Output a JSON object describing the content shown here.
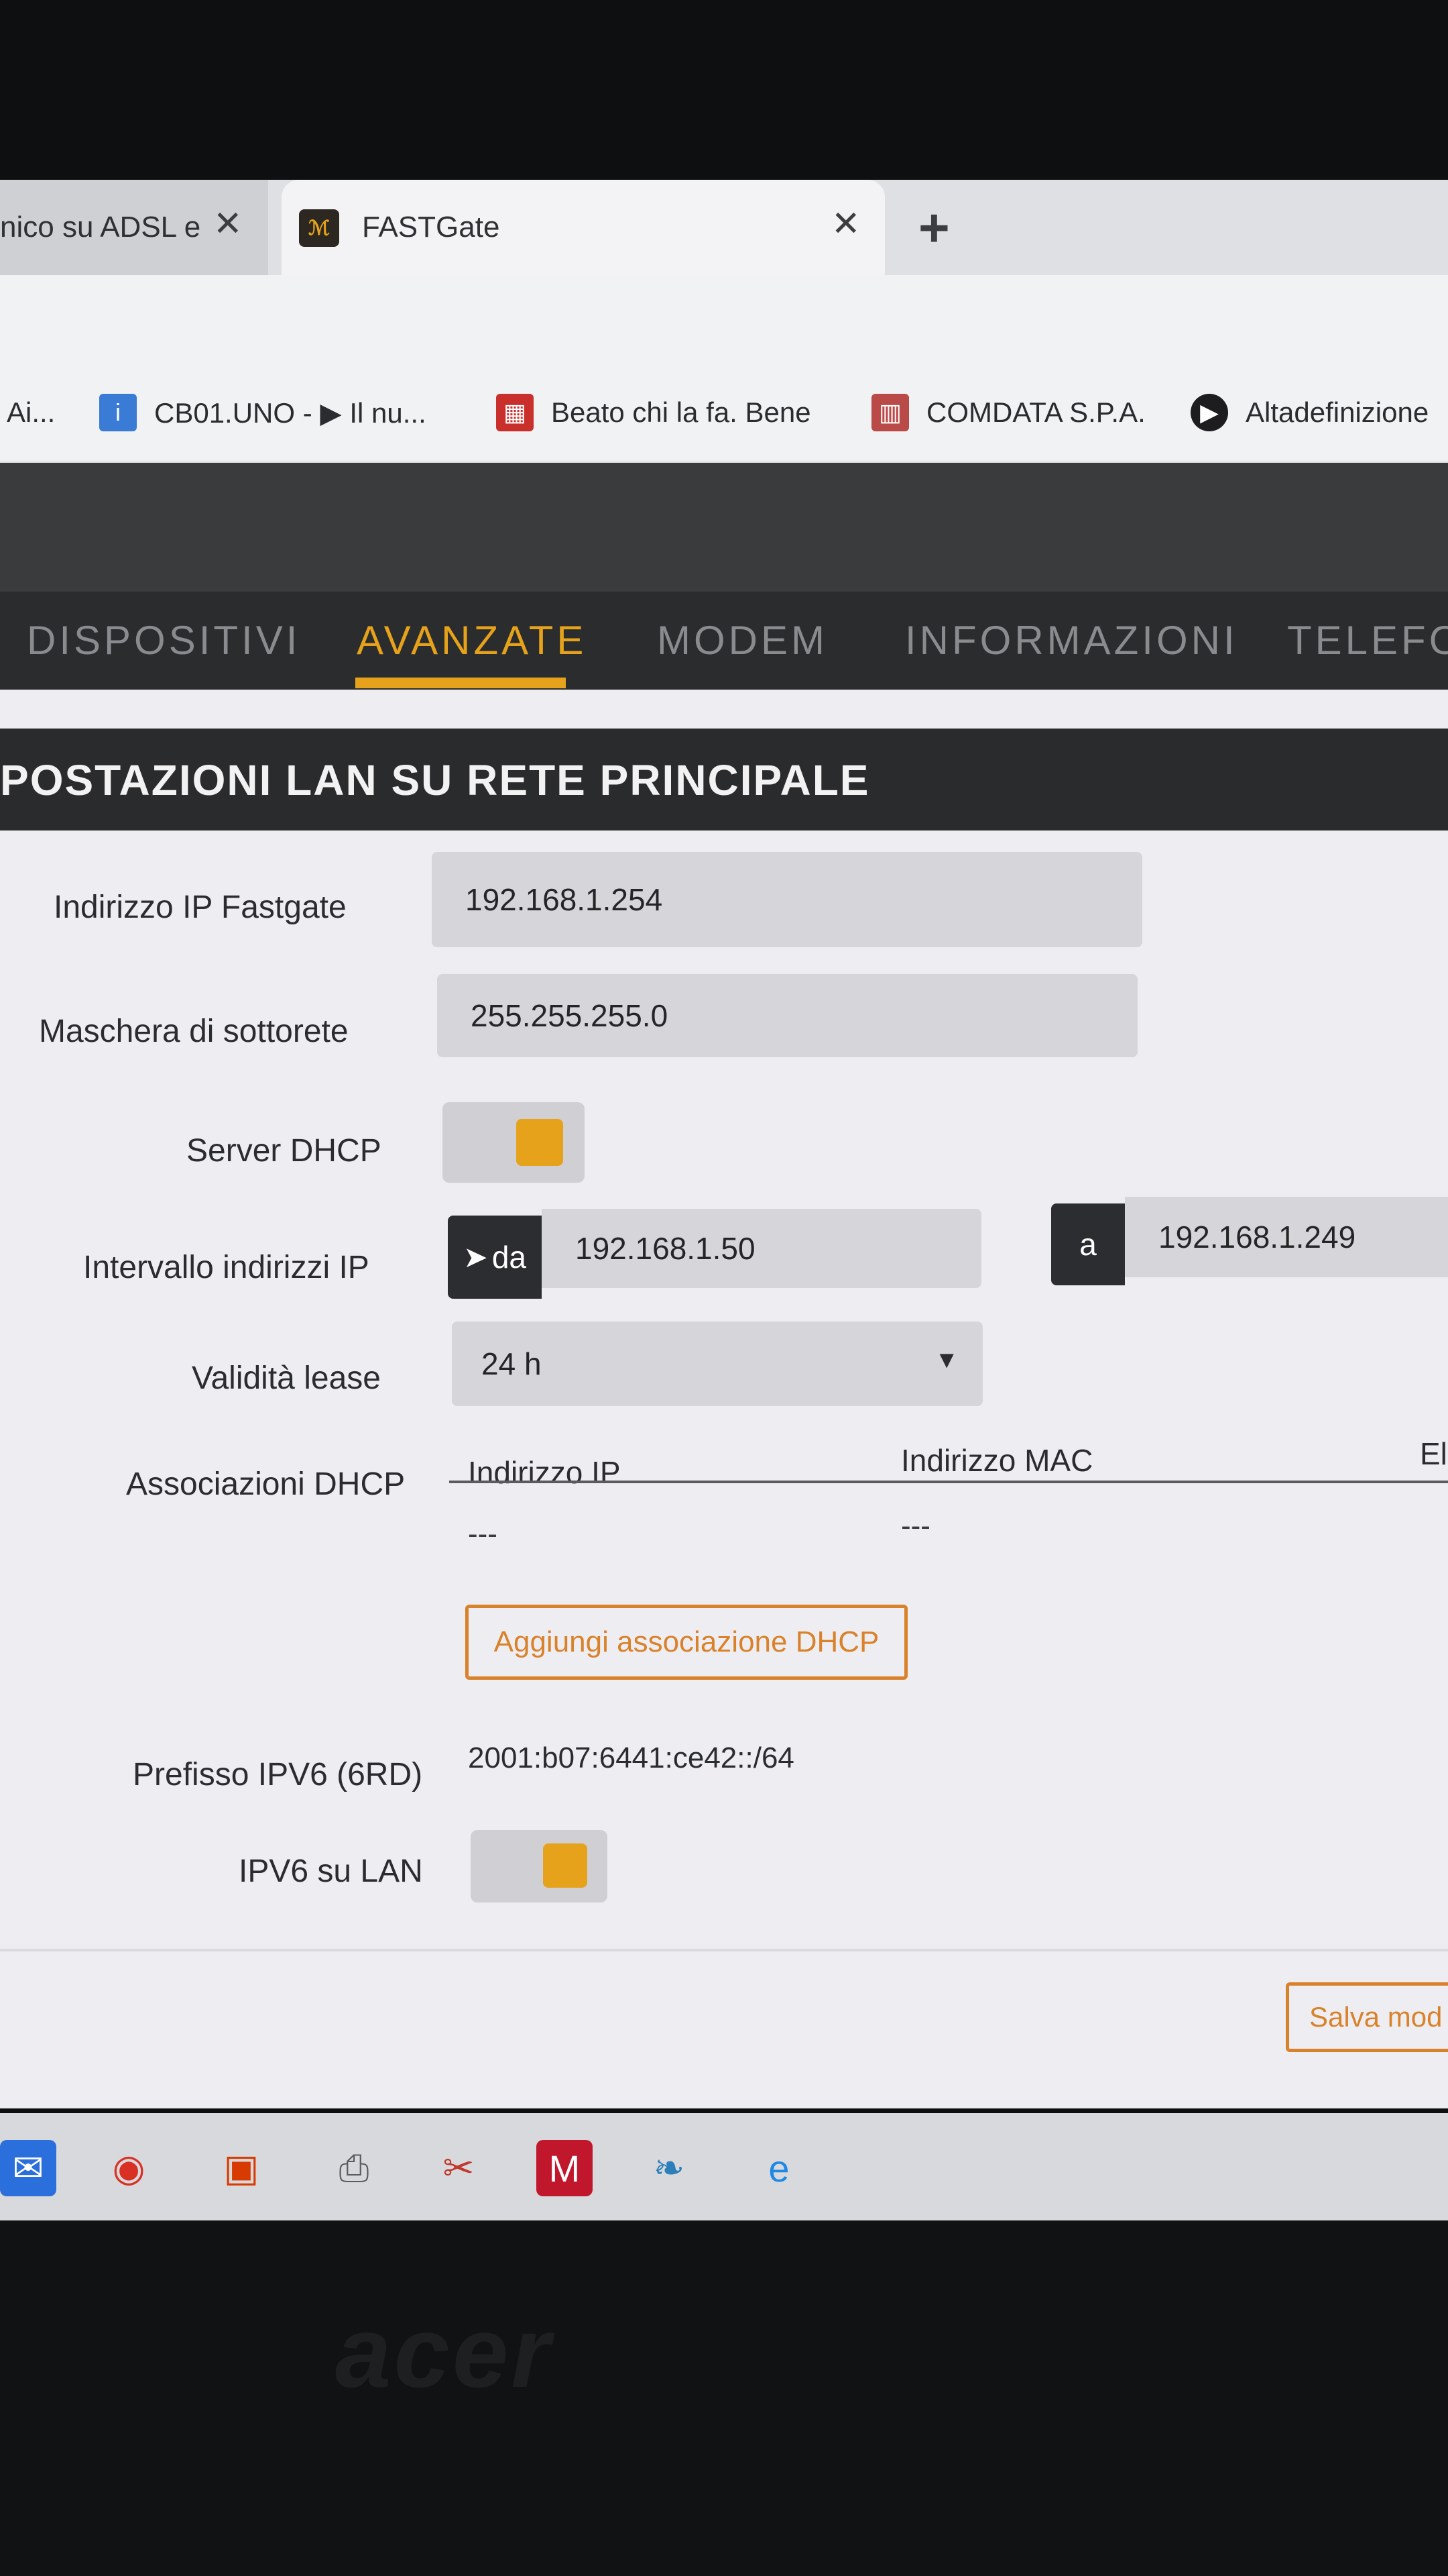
{
  "browser": {
    "tabs": [
      {
        "title": "nico su ADSL e"
      },
      {
        "title": "FASTGate",
        "favicon_text": "ℳ"
      }
    ],
    "new_tab_symbol": "+",
    "close_symbol": "✕",
    "bookmarks": [
      {
        "label": "Ai...",
        "icon": "page-icon"
      },
      {
        "label": "CB01.UNO - ▶ Il nu...",
        "icon": "info-icon"
      },
      {
        "label": "Beato chi la fa. Bene",
        "icon": "gift-icon"
      },
      {
        "label": "COMDATA S.P.A.",
        "icon": "building-icon"
      },
      {
        "label": "Altadefinizione",
        "icon": "play-icon"
      }
    ]
  },
  "nav": {
    "items": [
      "DISPOSITIVI",
      "AVANZATE",
      "MODEM",
      "INFORMAZIONI",
      "TELEFON"
    ],
    "active": "AVANZATE"
  },
  "section": {
    "title": "POSTAZIONI LAN SU RETE PRINCIPALE"
  },
  "form": {
    "ip_label": "Indirizzo IP Fastgate",
    "ip_value": "192.168.1.254",
    "mask_label": "Maschera di sottorete",
    "mask_value": "255.255.255.0",
    "dhcp_label": "Server DHCP",
    "dhcp_enabled": true,
    "range_label": "Intervallo indirizzi IP",
    "range_from_tag": "da",
    "range_from": "192.168.1.50",
    "range_to_tag": "a",
    "range_to": "192.168.1.249",
    "lease_label": "Validità lease",
    "lease_value": "24 h",
    "assoc_label": "Associazioni DHCP",
    "assoc_columns": [
      "Indirizzo IP",
      "Indirizzo MAC",
      "El"
    ],
    "assoc_rows": [
      [
        "---",
        "---"
      ]
    ],
    "add_button": "Aggiungi associazione DHCP",
    "ipv6_prefix_label": "Prefisso IPV6 (6RD)",
    "ipv6_prefix_value": "2001:b07:6441:ce42::/64",
    "ipv6_lan_label": "IPV6 su LAN",
    "ipv6_lan_enabled": true,
    "save_button": "Salva mod"
  },
  "colors": {
    "accent": "#e6a21a",
    "button_border": "#d9822b",
    "dark_bar": "#2a2b2d"
  },
  "taskbar": {
    "icons": [
      "mail-icon",
      "chrome-icon",
      "office-icon",
      "printer-icon",
      "scissors-icon",
      "mcafee-icon",
      "bird-icon",
      "internet-explorer-icon"
    ]
  },
  "laptop": {
    "brand": "acer"
  }
}
